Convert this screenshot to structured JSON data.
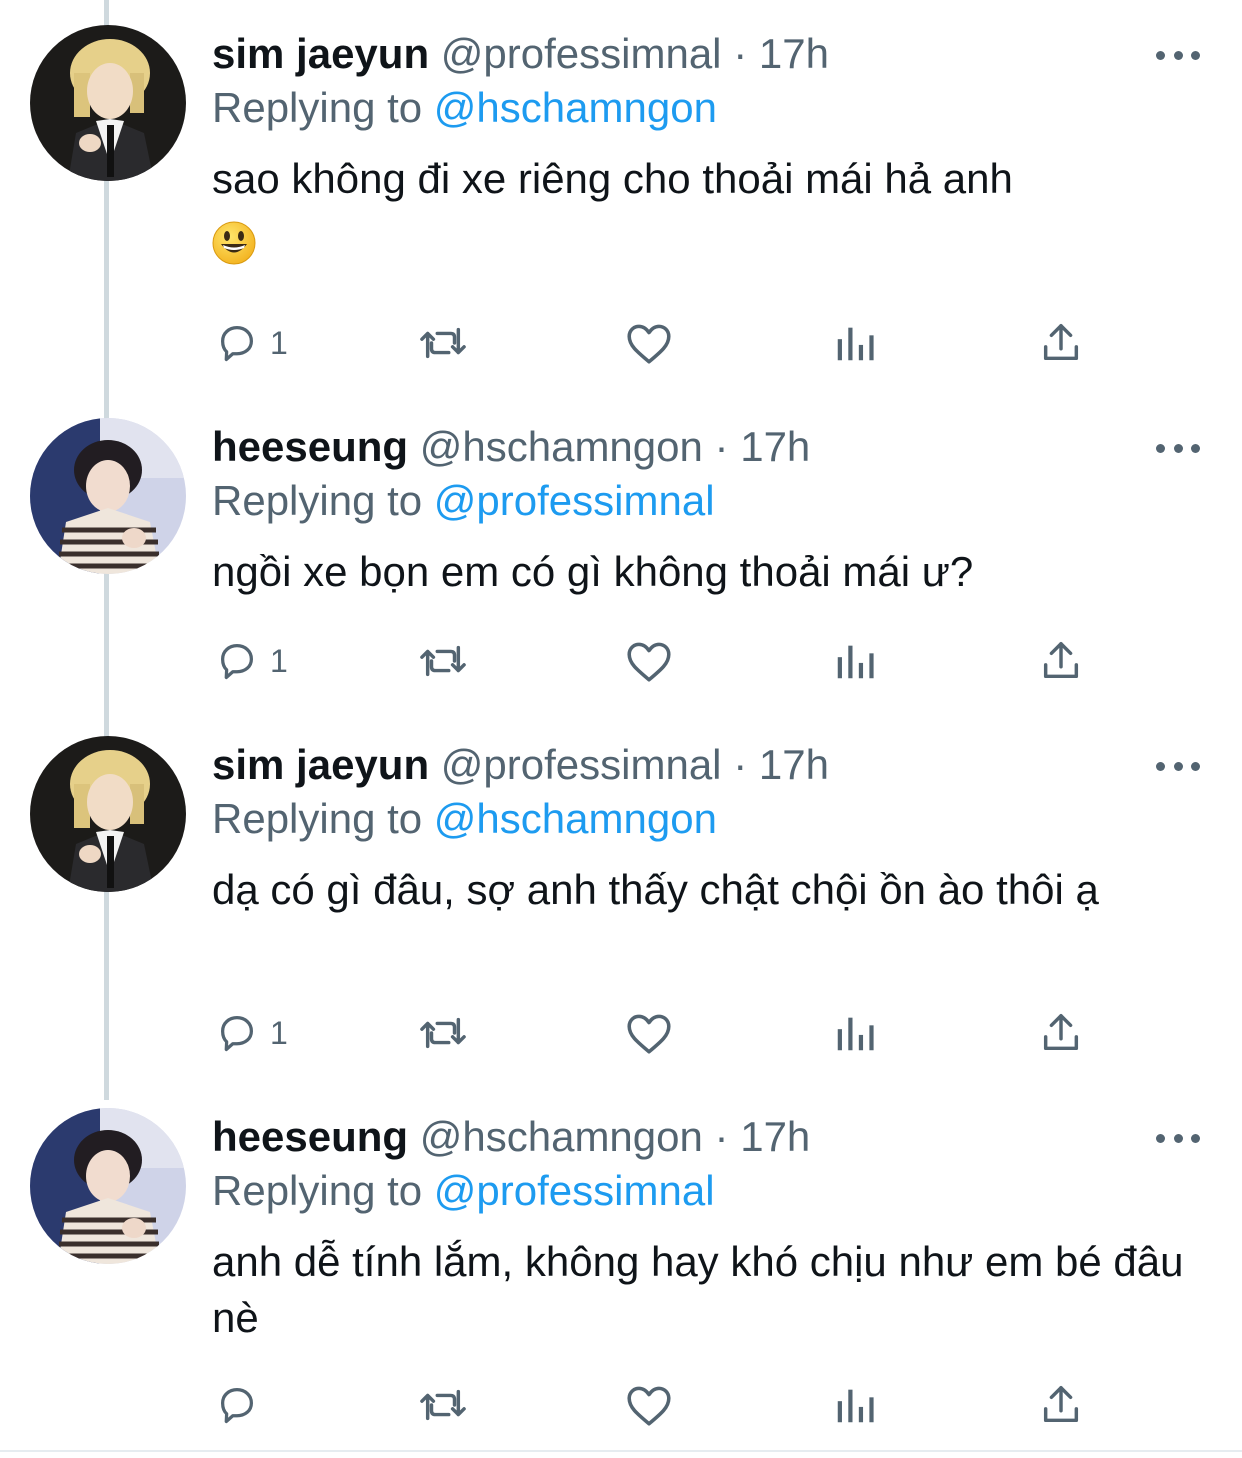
{
  "tweets": [
    {
      "name": "sim jaeyun",
      "handle": "@professimnal",
      "dot": "·",
      "time": "17h",
      "replying_label": "Replying to",
      "replying_to": "@hschamngon",
      "text": "sao không đi xe riêng cho thoải mái hả anh",
      "emoji": "grinning-face-emoji",
      "reply_count": "1",
      "avatar": "sim-jaeyun-avatar"
    },
    {
      "name": "heeseung",
      "handle": "@hschamngon",
      "dot": "·",
      "time": "17h",
      "replying_label": "Replying to",
      "replying_to": "@professimnal",
      "text": "ngồi xe bọn em có gì không thoải mái ư?",
      "reply_count": "1",
      "avatar": "heeseung-avatar"
    },
    {
      "name": "sim jaeyun",
      "handle": "@professimnal",
      "dot": "·",
      "time": "17h",
      "replying_label": "Replying to",
      "replying_to": "@hschamngon",
      "text": "dạ có gì đâu, sợ anh thấy chật chội ồn ào thôi ạ",
      "reply_count": "1",
      "avatar": "sim-jaeyun-avatar"
    },
    {
      "name": "heeseung",
      "handle": "@hschamngon",
      "dot": "·",
      "time": "17h",
      "replying_label": "Replying to",
      "replying_to": "@professimnal",
      "text": "anh dễ tính lắm, không hay khó chịu như em bé đâu nè",
      "reply_count": "",
      "avatar": "heeseung-avatar"
    }
  ],
  "colors": {
    "link": "#1d9bf0",
    "secondary_text": "#536471",
    "primary_text": "#0f1419",
    "thread_line": "#cfd9de"
  }
}
